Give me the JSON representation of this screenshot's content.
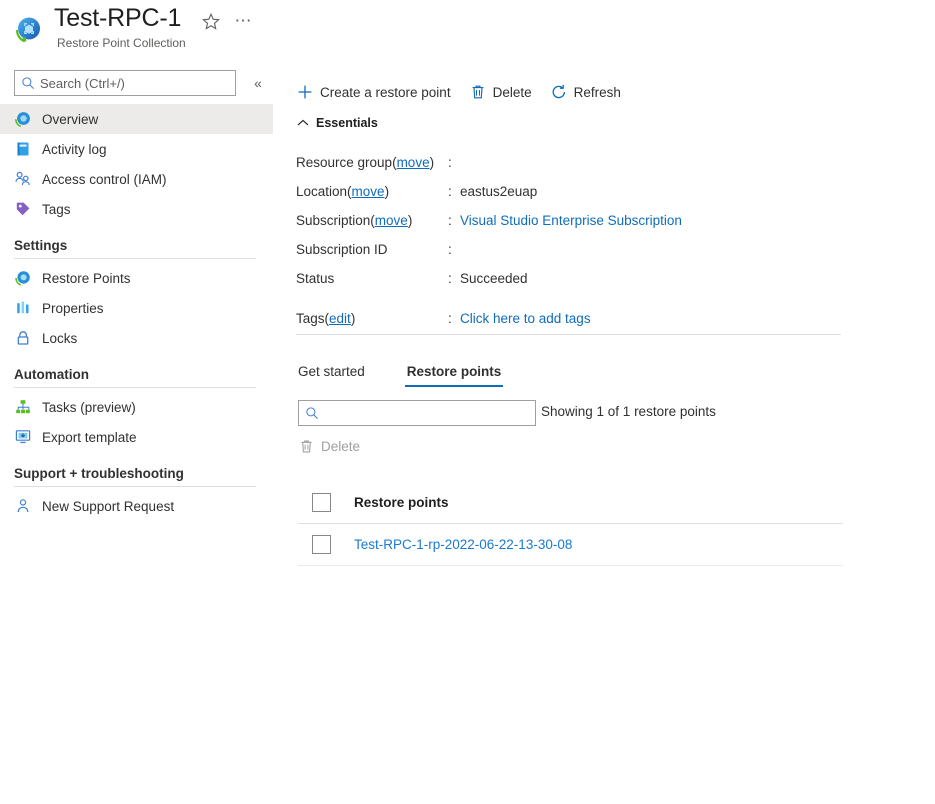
{
  "resource": {
    "title": "Test-RPC-1",
    "subtitle": "Restore Point Collection",
    "icon": "restore-point-collection-icon",
    "favorite_icon": "star-icon",
    "more_icon": "ellipsis-icon"
  },
  "sidebar": {
    "search": {
      "placeholder": "Search (Ctrl+/)",
      "value": "",
      "icon": "search-icon"
    },
    "collapse_icon": "chevron-double-left-icon",
    "items": [
      {
        "label": "Overview",
        "icon": "overview-icon",
        "selected": true
      },
      {
        "label": "Activity log",
        "icon": "activity-log-icon",
        "selected": false
      },
      {
        "label": "Access control (IAM)",
        "icon": "access-control-icon",
        "selected": false
      },
      {
        "label": "Tags",
        "icon": "tags-icon",
        "selected": false
      }
    ],
    "groups": [
      {
        "title": "Settings",
        "items": [
          {
            "label": "Restore Points",
            "icon": "restore-points-icon"
          },
          {
            "label": "Properties",
            "icon": "properties-icon"
          },
          {
            "label": "Locks",
            "icon": "lock-icon"
          }
        ]
      },
      {
        "title": "Automation",
        "items": [
          {
            "label": "Tasks (preview)",
            "icon": "tasks-icon"
          },
          {
            "label": "Export template",
            "icon": "export-template-icon"
          }
        ]
      },
      {
        "title": "Support + troubleshooting",
        "items": [
          {
            "label": "New Support Request",
            "icon": "support-request-icon"
          }
        ]
      }
    ]
  },
  "command_bar": [
    {
      "label": "Create a restore point",
      "icon": "plus-icon"
    },
    {
      "label": "Delete",
      "icon": "trash-icon"
    },
    {
      "label": "Refresh",
      "icon": "refresh-icon"
    }
  ],
  "essentials": {
    "header": "Essentials",
    "collapse_icon": "chevron-up-icon",
    "rows": [
      {
        "key": "Resource group",
        "key_link": "move",
        "colon": ":",
        "value": "",
        "value_is_link": false
      },
      {
        "key": "Location",
        "key_link": "move",
        "colon": ":",
        "value": "eastus2euap",
        "value_is_link": false
      },
      {
        "key": "Subscription",
        "key_link": "move",
        "colon": ":",
        "value": "Visual Studio Enterprise Subscription",
        "value_is_link": true
      },
      {
        "key": "Subscription ID",
        "key_link": "",
        "colon": ":",
        "value": "",
        "value_is_link": false
      },
      {
        "key": "Status",
        "key_link": "",
        "colon": ":",
        "value": "Succeeded",
        "value_is_link": false
      }
    ],
    "tags_row": {
      "key": "Tags",
      "key_link": "edit",
      "colon": ":",
      "value": "Click here to add tags",
      "value_is_link": true
    }
  },
  "tabs": [
    {
      "label": "Get started",
      "active": false
    },
    {
      "label": "Restore points",
      "active": true
    }
  ],
  "list": {
    "search": {
      "placeholder": "",
      "value": "",
      "icon": "search-icon"
    },
    "showing": "Showing 1 of 1 restore points",
    "toolbar": [
      {
        "label": "Delete",
        "icon": "trash-icon",
        "disabled": true
      }
    ],
    "column_header": "Restore points",
    "rows": [
      {
        "name": "Test-RPC-1-rp-2022-06-22-13-30-08",
        "checked": false
      }
    ]
  },
  "colors": {
    "accent": "#0f6cbd",
    "link": "#1a7ad4",
    "selected_bg": "#edebe9",
    "text": "#323130",
    "muted": "#605e5c"
  }
}
